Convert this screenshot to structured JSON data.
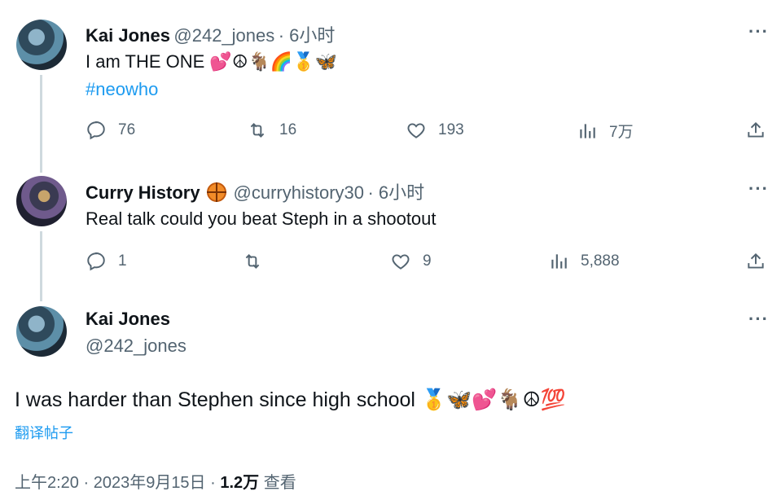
{
  "tweets": [
    {
      "name": "Kai Jones",
      "handle": "@242_jones",
      "time": "· 6小时",
      "text": "I am THE ONE",
      "emojis": "💕☮🐐🌈🥇🦋",
      "hashtag": "#neowho",
      "replies": "76",
      "retweets": "16",
      "likes": "193",
      "views": "7万"
    },
    {
      "name": "Curry History",
      "handle": "@curryhistory30",
      "time": "· 6小时",
      "text": "Real talk could you beat Steph in a shootout",
      "replies": "1",
      "retweets": "",
      "likes": "9",
      "views": "5,888"
    }
  ],
  "main_tweet": {
    "name": "Kai Jones",
    "handle": "@242_jones",
    "text": "I was harder than Stephen since high school",
    "emojis": "🥇🦋💕🐐☮💯",
    "translate": "翻译帖子",
    "timestamp": "上午2:20 · 2023年9月15日 · ",
    "views_count": "1.2万",
    "views_label": " 查看"
  },
  "more_label": "···",
  "icons": [
    "reply-icon",
    "retweet-icon",
    "like-icon",
    "views-icon",
    "share-icon",
    "more-icon"
  ]
}
